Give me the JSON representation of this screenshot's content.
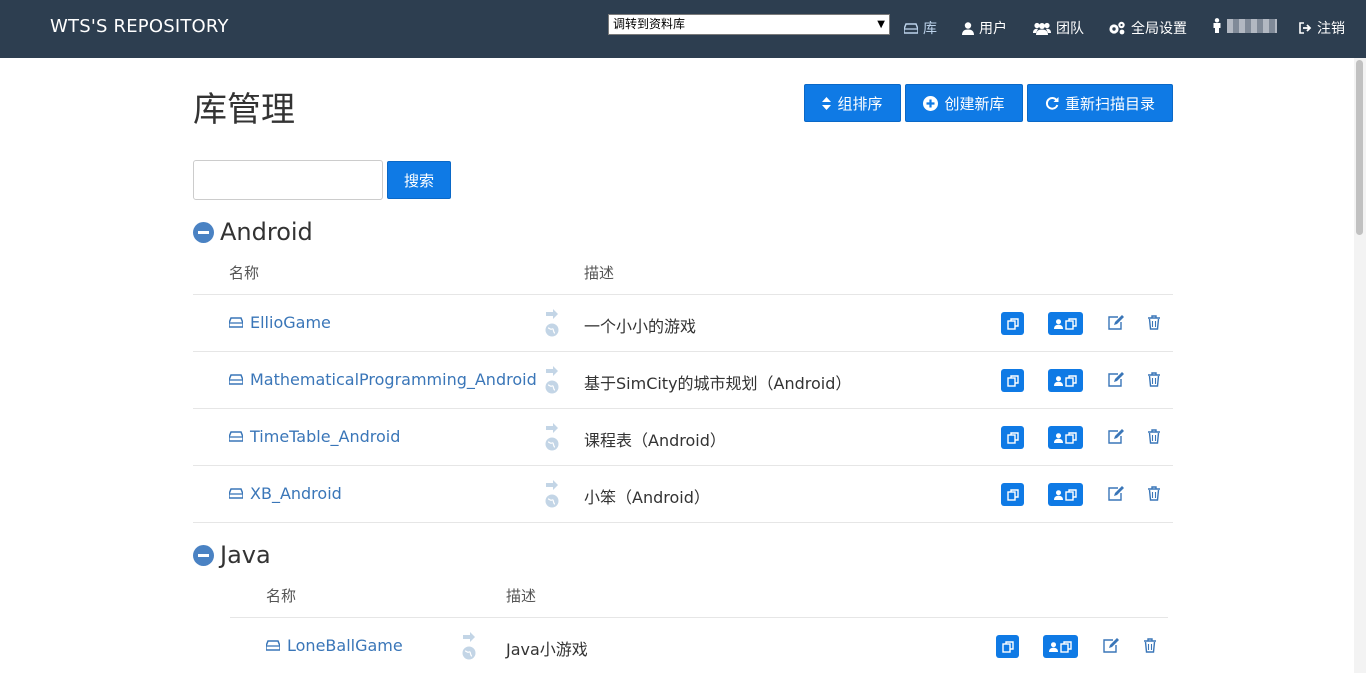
{
  "nav": {
    "brand": "WTS'S REPOSITORY",
    "repo_select": "调转到资料库",
    "items": [
      {
        "label": "库",
        "icon": "hdd-icon",
        "active": true
      },
      {
        "label": "用户",
        "icon": "user-icon"
      },
      {
        "label": "团队",
        "icon": "group-icon"
      },
      {
        "label": "全局设置",
        "icon": "cogs-icon"
      },
      {
        "label": "注销",
        "icon": "signout-icon"
      }
    ]
  },
  "page": {
    "title": "库管理",
    "buttons": {
      "sort": "组排序",
      "create": "创建新库",
      "rescan": "重新扫描目录"
    },
    "search_button": "搜索",
    "search_placeholder": ""
  },
  "columns": {
    "name": "名称",
    "description": "描述"
  },
  "groups": [
    {
      "name": "Android",
      "repos": [
        {
          "name": "EllioGame",
          "description": "一个小小的游戏"
        },
        {
          "name": "MathematicalProgramming_Android",
          "description": "基于SimCity的城市规划（Android）"
        },
        {
          "name": "TimeTable_Android",
          "description": "课程表（Android）"
        },
        {
          "name": "XB_Android",
          "description": "小笨（Android）"
        }
      ]
    },
    {
      "name": "Java",
      "repos": [
        {
          "name": "LoneBallGame",
          "description": "Java小游戏"
        }
      ]
    }
  ],
  "colors": {
    "navbar": "#2d3e50",
    "primary": "#0f7ae5",
    "link": "#3a76b8"
  }
}
